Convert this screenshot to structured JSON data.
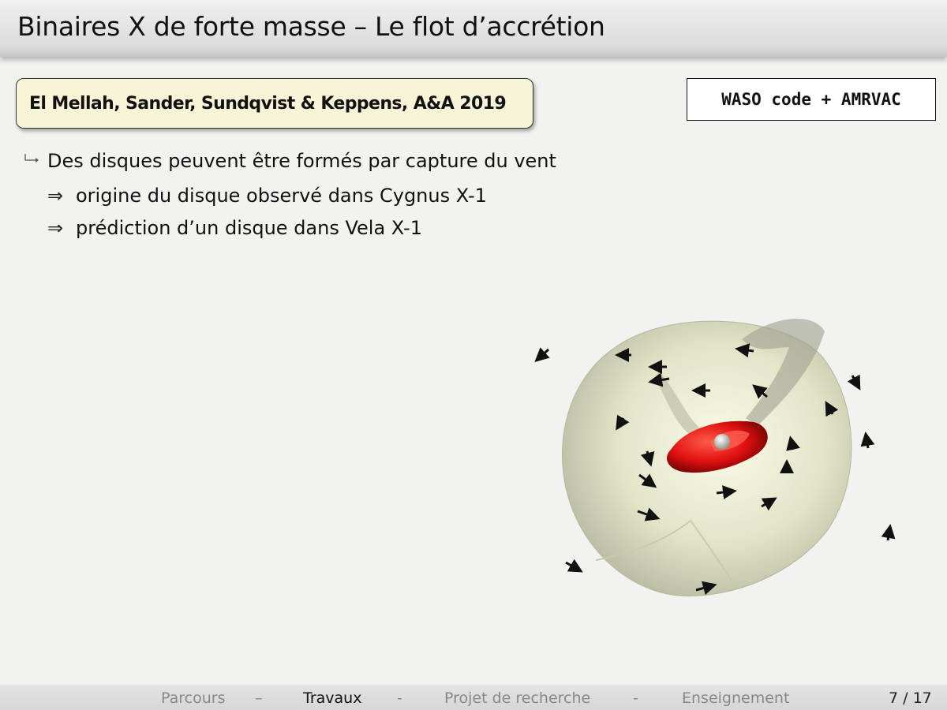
{
  "title": "Binaires X de forte masse – Le flot d’accrétion",
  "reference": {
    "lead_author": "El Mellah",
    "rest": ", Sander, Sundqvist & Keppens, A&A 2019"
  },
  "code_label": "WASO code + AMRVAC",
  "bullets": {
    "main_prefix": "Des ",
    "main_strong": "disques peuvent être formés par capture du vent",
    "implies_symbol": "⇒",
    "sub1": "origine du disque observé dans Cygnus X-1",
    "sub2": "prédiction d’un disque dans Vela X-1"
  },
  "footer": {
    "nav": [
      "Parcours",
      "–",
      "Travaux",
      "-",
      "Projet de recherche",
      "-",
      "Enseignement"
    ],
    "active": "Travaux",
    "page": "7 / 17"
  }
}
